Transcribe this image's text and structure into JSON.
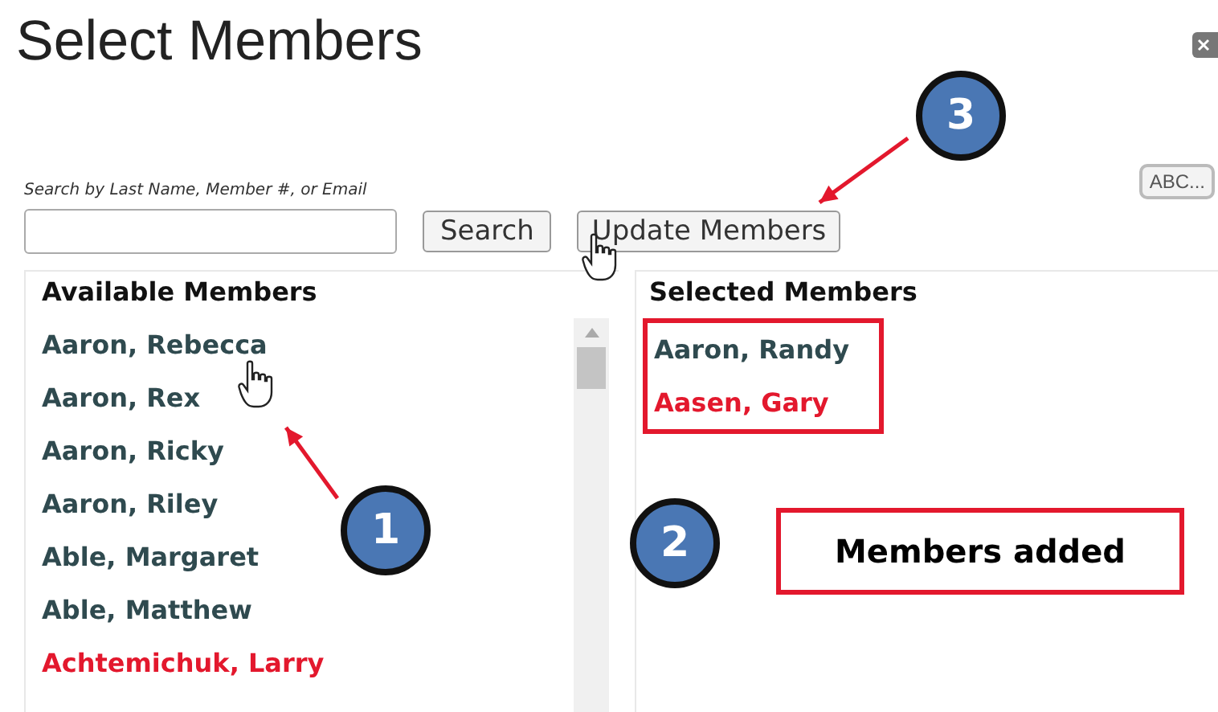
{
  "window": {
    "title": "Select Members"
  },
  "search": {
    "hint": "Search by Last Name, Member #, or Email"
  },
  "buttons": {
    "search": "Search",
    "update": "Update Members",
    "sort": "ABC..."
  },
  "available": {
    "title": "Available Members",
    "members": [
      {
        "name": "Aaron, Rebecca",
        "color": "#2f4a4f"
      },
      {
        "name": "Aaron, Rex",
        "color": "#2f4a4f"
      },
      {
        "name": "Aaron, Ricky",
        "color": "#2f4a4f"
      },
      {
        "name": "Aaron, Riley",
        "color": "#2f4a4f"
      },
      {
        "name": "Able, Margaret",
        "color": "#2f4a4f"
      },
      {
        "name": "Able, Matthew",
        "color": "#2f4a4f"
      },
      {
        "name": "Achtemichuk, Larry",
        "color": "#e3182d"
      }
    ]
  },
  "selected": {
    "title": "Selected Members",
    "outlined": true,
    "members": [
      {
        "name": "Aaron, Randy",
        "color": "#2f4a4f"
      },
      {
        "name": "Aasen, Gary",
        "color": "#e3182d"
      }
    ]
  },
  "annotations": [
    {
      "kind": "badge",
      "label": "1"
    },
    {
      "kind": "badge",
      "label": "2"
    },
    {
      "kind": "badge",
      "label": "3"
    },
    {
      "kind": "note",
      "text": "Members added"
    },
    {
      "kind": "arrow"
    },
    {
      "kind": "arrow"
    },
    {
      "kind": "cursor"
    },
    {
      "kind": "cursor"
    }
  ]
}
